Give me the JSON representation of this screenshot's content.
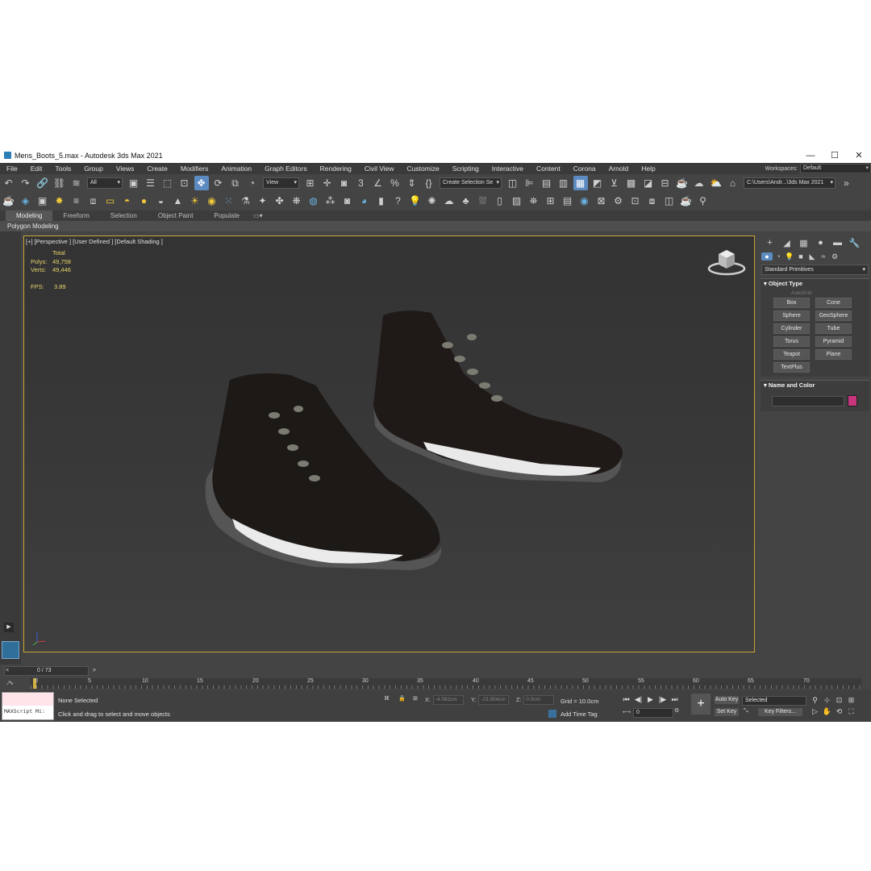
{
  "window": {
    "title": "Mens_Boots_5.max - Autodesk 3ds Max 2021"
  },
  "menu": [
    "File",
    "Edit",
    "Tools",
    "Group",
    "Views",
    "Create",
    "Modifiers",
    "Animation",
    "Graph Editors",
    "Rendering",
    "Civil View",
    "Customize",
    "Scripting",
    "Interactive",
    "Content",
    "Corona",
    "Arnold",
    "Help"
  ],
  "workspace": {
    "label": "Workspaces:",
    "value": "Default"
  },
  "toolbar": {
    "filter_value": "All",
    "view_value": "View",
    "selection_set": "Create Selection Se",
    "path": "C:\\Users\\Andr...\\3ds Max 2021"
  },
  "ribbon": {
    "tabs": [
      "Modeling",
      "Freeform",
      "Selection",
      "Object Paint",
      "Populate"
    ],
    "sub_label": "Polygon Modeling"
  },
  "viewport": {
    "label": "[+] [Perspective ] [User Defined ] [Default Shading ]",
    "stats": {
      "header": "Total",
      "polys_label": "Polys:",
      "polys": "49,758",
      "verts_label": "Verts:",
      "verts": "49,446",
      "fps_label": "FPS:",
      "fps": "3.89"
    }
  },
  "command_panel": {
    "dropdown": "Standard Primitives",
    "object_type_title": "Object Type",
    "autogrid": "AutoGrid",
    "buttons": [
      "Box",
      "Cone",
      "Sphere",
      "GeoSphere",
      "Cylinder",
      "Tube",
      "Torus",
      "Pyramid",
      "Teapot",
      "Plane",
      "TextPlus"
    ],
    "name_color_title": "Name and Color",
    "swatch_color": "#c7357f"
  },
  "timeline": {
    "position": "0 / 73",
    "ticks": [
      "0",
      "5",
      "10",
      "15",
      "20",
      "25",
      "30",
      "35",
      "40",
      "45",
      "50",
      "55",
      "60",
      "65",
      "70"
    ]
  },
  "status": {
    "maxscript": "MAXScript Mi:",
    "selection": "None Selected",
    "prompt": "Click and drag to select and move objects",
    "x_label": "X:",
    "x_value": "-4.082cm",
    "y_label": "Y:",
    "y_value": "-23.954cm",
    "z_label": "Z:",
    "z_value": "0.0cm",
    "grid": "Grid = 10.0cm",
    "add_time_tag": "Add Time Tag",
    "frame": "0",
    "auto_key": "Auto Key",
    "selected": "Selected",
    "set_key": "Set Key",
    "key_filters": "Key Filters..."
  }
}
